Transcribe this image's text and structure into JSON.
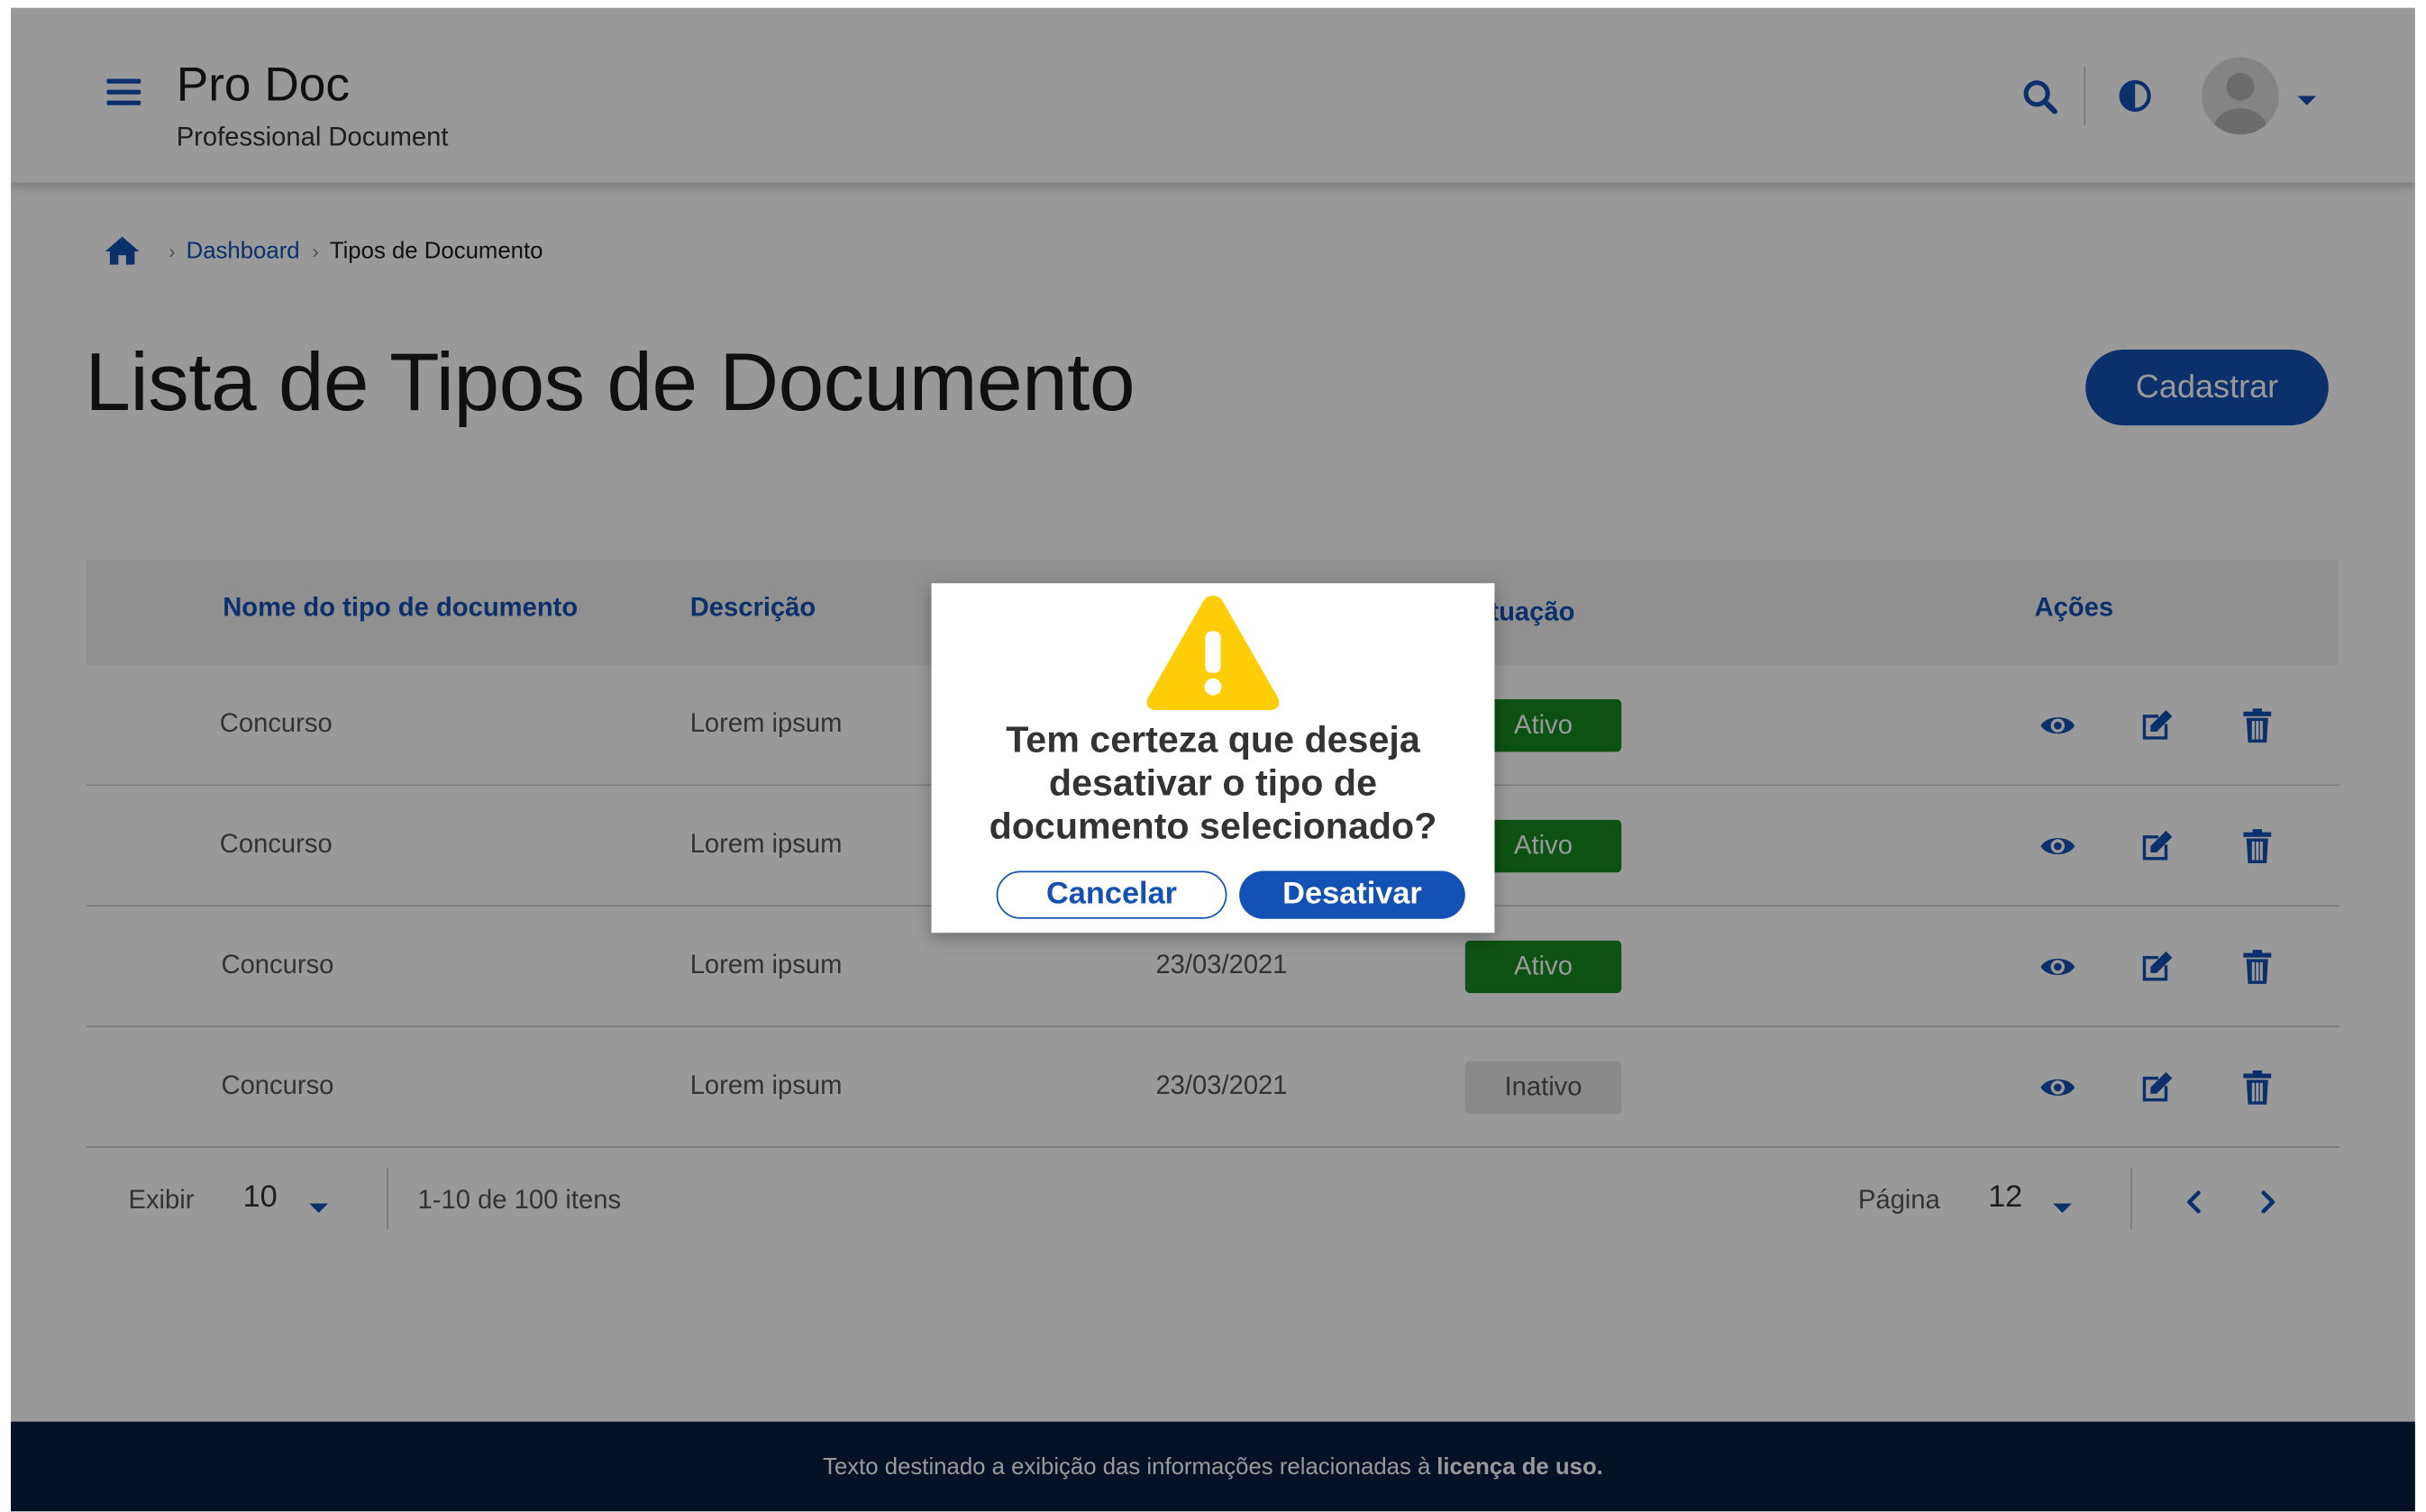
{
  "header": {
    "title": "Pro Doc",
    "subtitle": "Professional Document",
    "icons": [
      "menu-icon",
      "search-icon",
      "contrast-icon",
      "avatar-icon",
      "caret-down-icon"
    ]
  },
  "breadcrumb": {
    "items": [
      "Dashboard",
      "Tipos de Documento"
    ]
  },
  "page": {
    "title": "Lista de Tipos de Documento",
    "register_label": "Cadastrar"
  },
  "table": {
    "columns": [
      "Nome do tipo de documento",
      "Descrição",
      "Situação",
      "Ações"
    ],
    "rows": [
      {
        "name": "Concurso",
        "description": "Lorem ipsum",
        "date": "",
        "status": "Ativo"
      },
      {
        "name": "Concurso",
        "description": "Lorem ipsum",
        "date": "",
        "status": "Ativo"
      },
      {
        "name": "Concurso",
        "description": "Lorem ipsum",
        "date": "23/03/2021",
        "status": "Ativo"
      },
      {
        "name": "Concurso",
        "description": "Lorem ipsum",
        "date": "23/03/2021",
        "status": "Inativo"
      }
    ]
  },
  "pagination": {
    "show_label": "Exibir",
    "page_size": "10",
    "range_text": "1-10 de 100 itens",
    "page_label": "Página",
    "page_value": "12"
  },
  "footer": {
    "text": "Texto destinado a exibição das informações relacionadas à",
    "bold_text": "licença de uso."
  },
  "modal": {
    "message": "Tem certeza que deseja desativar o tipo de documento selecionado?",
    "cancel_label": "Cancelar",
    "confirm_label": "Desativar"
  },
  "colors": {
    "primary": "#1351b4",
    "active_badge": "#168821",
    "inactive_badge": "#e6e6e6",
    "footer": "#071d41",
    "warning": "#ffcd07"
  }
}
